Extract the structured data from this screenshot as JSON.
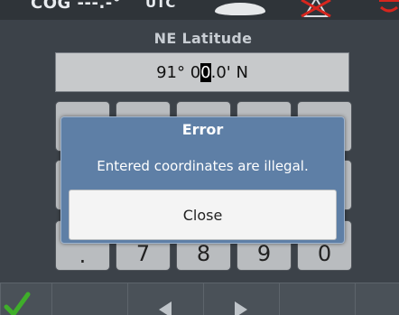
{
  "status_bar": {
    "cog": "COG ---.-°",
    "utc": "UTC"
  },
  "header": {
    "title": "NE Latitude"
  },
  "coordinate": {
    "before_cursor": "91° 0",
    "cursor_char": "0",
    "after_cursor": ".0' N"
  },
  "keypad": {
    "row3": [
      ".",
      "7",
      "8",
      "9",
      "0"
    ]
  },
  "dialog": {
    "title": "Error",
    "message": "Entered coordinates are illegal.",
    "close_label": "Close"
  },
  "icons": {
    "confirm": "checkmark-icon",
    "prev": "arrow-left-icon",
    "next": "arrow-right-icon"
  },
  "colors": {
    "dialog_bg": "#5e7fa6",
    "confirm_green": "#3fae2a",
    "alarm_red": "#d7261e"
  }
}
